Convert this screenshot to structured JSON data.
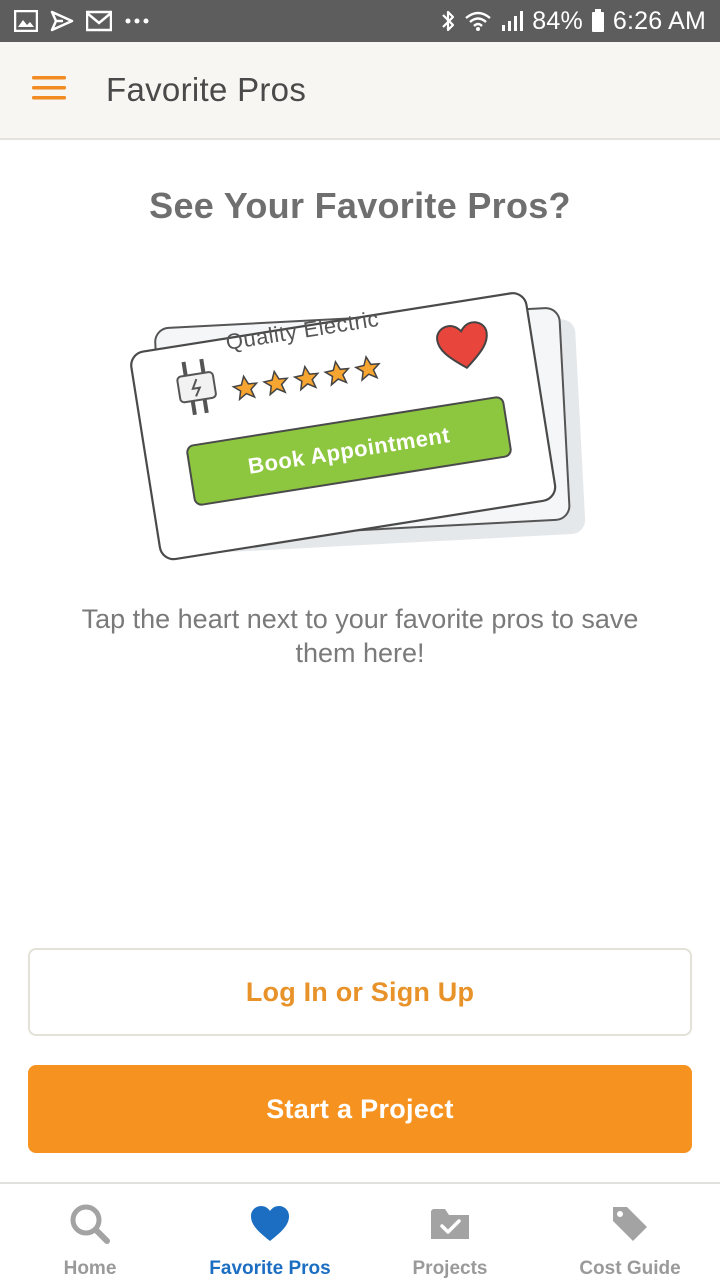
{
  "status_bar": {
    "battery": "84%",
    "time": "6:26 AM",
    "icons_left": [
      "image-icon",
      "send-icon",
      "gmail-icon",
      "more-dots-icon"
    ],
    "icons_right": [
      "bluetooth-icon",
      "wifi-icon",
      "signal-icon",
      "battery-icon"
    ]
  },
  "app_bar": {
    "title": "Favorite Pros",
    "menu_icon": "hamburger-menu-icon"
  },
  "main": {
    "heading": "See Your Favorite Pros?",
    "card": {
      "company": "Quality Electric",
      "rating_stars": 5,
      "button_label": "Book Appointment"
    },
    "subtitle": "Tap the heart next to your favorite pros to save them here!",
    "login_label": "Log In or Sign Up",
    "start_label": "Start a Project"
  },
  "bottom_nav": {
    "items": [
      {
        "label": "Home",
        "icon": "search-icon"
      },
      {
        "label": "Favorite Pros",
        "icon": "heart-icon",
        "active": true
      },
      {
        "label": "Projects",
        "icon": "folder-check-icon"
      },
      {
        "label": "Cost Guide",
        "icon": "tag-icon"
      }
    ]
  },
  "colors": {
    "accent_orange": "#f69320",
    "active_blue": "#1b6ec2",
    "card_green": "#8dc63f",
    "heart_red": "#e8453c",
    "star_orange": "#f7a531"
  }
}
